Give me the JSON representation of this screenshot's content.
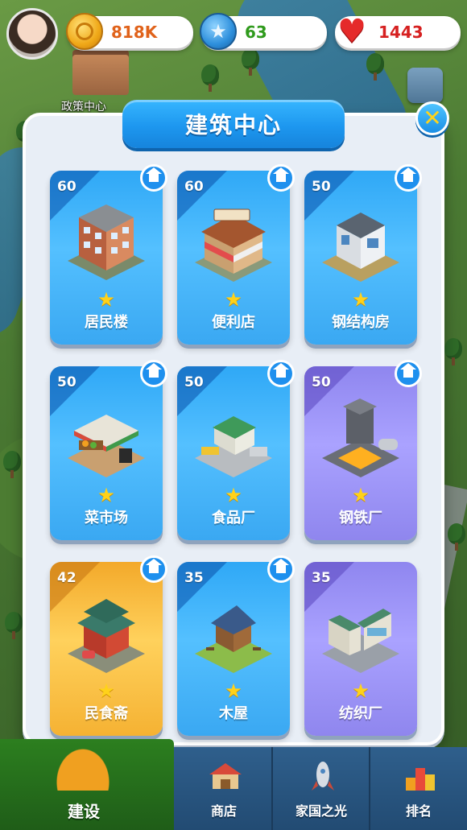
{
  "resources": {
    "coins": "818K",
    "stars": "63",
    "hearts": "1443"
  },
  "map": {
    "policy_center_label": "政策中心"
  },
  "dialog": {
    "title": "建筑中心"
  },
  "cards": [
    {
      "level": "60",
      "name": "居民楼",
      "theme": "blue",
      "has_home_badge": true
    },
    {
      "level": "60",
      "name": "便利店",
      "theme": "blue",
      "has_home_badge": true
    },
    {
      "level": "50",
      "name": "钢结构房",
      "theme": "blue",
      "has_home_badge": true
    },
    {
      "level": "50",
      "name": "菜市场",
      "theme": "blue",
      "has_home_badge": true
    },
    {
      "level": "50",
      "name": "食品厂",
      "theme": "blue",
      "has_home_badge": true
    },
    {
      "level": "50",
      "name": "钢铁厂",
      "theme": "purple",
      "has_home_badge": true
    },
    {
      "level": "42",
      "name": "民食斋",
      "theme": "gold",
      "has_home_badge": true
    },
    {
      "level": "35",
      "name": "木屋",
      "theme": "blue",
      "has_home_badge": true
    },
    {
      "level": "35",
      "name": "纺织厂",
      "theme": "purple",
      "has_home_badge": false
    }
  ],
  "bottom_nav": {
    "build": "建设",
    "shop": "商店",
    "homeland": "家国之光",
    "ranking": "排名"
  },
  "colors": {
    "accent_blue": "#1d97ef",
    "star_yellow": "#ffd21a",
    "coin_text": "#e0621a",
    "star_text": "#2f9a1c",
    "heart_text": "#d62020"
  }
}
